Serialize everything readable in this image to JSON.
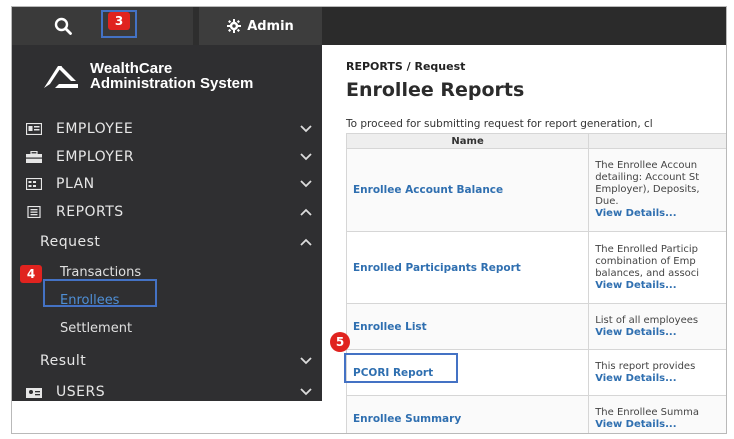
{
  "header": {
    "admin_label": "Admin"
  },
  "markers": {
    "step3": "3",
    "step4": "4",
    "step5": "5"
  },
  "brand": {
    "line1": "WealthCare",
    "line2": "Administration System"
  },
  "sidebar": {
    "items": [
      {
        "label": "EMPLOYEE",
        "icon": "id-card-icon"
      },
      {
        "label": "EMPLOYER",
        "icon": "briefcase-icon"
      },
      {
        "label": "PLAN",
        "icon": "plan-card-icon"
      },
      {
        "label": "REPORTS",
        "icon": "reports-icon"
      }
    ],
    "request": {
      "label": "Request",
      "children": [
        "Transactions",
        "Enrollees",
        "Settlement"
      ]
    },
    "result_label": "Result",
    "users_label": "USERS"
  },
  "content": {
    "breadcrumb": "REPORTS / Request",
    "title": "Enrollee Reports",
    "intro": "To proceed for submitting request for report generation, cl",
    "table": {
      "header": "Name",
      "rows": [
        {
          "name": "Enrollee Account Balance",
          "desc": [
            "The Enrollee Accoun",
            "detailing: Account St",
            "Employer), Deposits,",
            "Due."
          ],
          "link": "View Details..."
        },
        {
          "name": "Enrolled Participants Report",
          "desc": [
            "The Enrolled Particip",
            "combination of Emp",
            "balances, and associ"
          ],
          "link": "View Details..."
        },
        {
          "name": "Enrollee List",
          "desc": [
            "List of all employees"
          ],
          "link": "View Details..."
        },
        {
          "name": "PCORI Report",
          "desc": [
            "This report provides"
          ],
          "link": "View Details..."
        },
        {
          "name": "Enrollee Summary",
          "desc": [
            "The Enrollee Summa"
          ],
          "link": "View Details..."
        }
      ]
    }
  },
  "colors": {
    "sidebar_bg": "#2f2f31",
    "topbar_bg": "#2e2e2e",
    "link": "#2f6fb0",
    "marker": "#e0231f",
    "callout": "#4472c4"
  }
}
